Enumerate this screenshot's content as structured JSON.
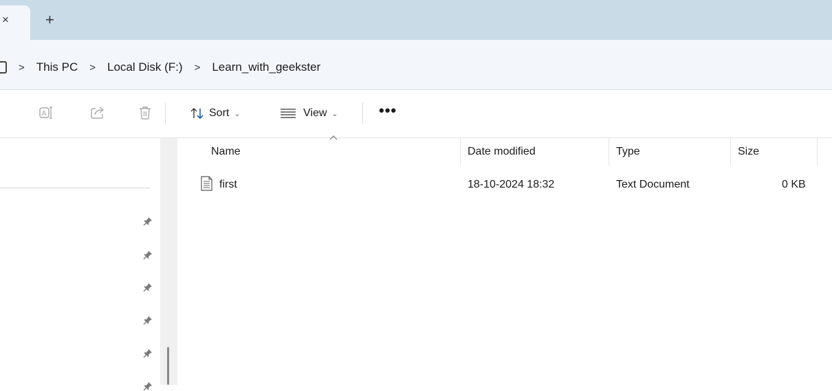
{
  "tabbar": {
    "close_glyph": "×",
    "new_tab_glyph": "+"
  },
  "breadcrumb": {
    "items": [
      "This PC",
      "Local Disk (F:)",
      "Learn_with_geekster"
    ],
    "separator": ">"
  },
  "commandbar": {
    "icons": [
      "rename-icon",
      "share-icon",
      "delete-icon"
    ],
    "sort_label": "Sort",
    "view_label": "View",
    "chevron": "⌄",
    "more_label": "•••"
  },
  "navpane": {
    "pinned_count": 6
  },
  "columns": {
    "name": "Name",
    "date_modified": "Date modified",
    "type": "Type",
    "size": "Size"
  },
  "files": [
    {
      "name": "first",
      "date_modified": "18-10-2024 18:32",
      "type": "Text Document",
      "size": "0 KB",
      "icon": "text-document-icon"
    }
  ],
  "colors": {
    "tabbar_bg": "#cadbe8",
    "addressbar_bg": "#f3f7fb",
    "icon_disabled": "#a9a9a9",
    "accent_blue": "#1f5fa8"
  }
}
